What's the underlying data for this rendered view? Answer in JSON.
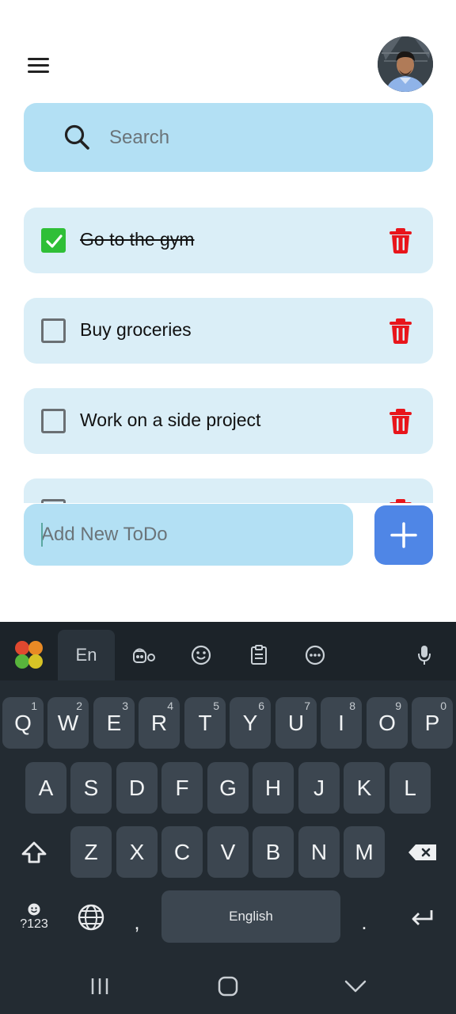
{
  "header": {
    "menu_icon": "hamburger-menu-icon",
    "avatar_icon": "user-avatar"
  },
  "search": {
    "placeholder": "Search",
    "icon": "search-icon"
  },
  "todos": [
    {
      "text": "Go to the gym",
      "done": true
    },
    {
      "text": "Buy groceries",
      "done": false
    },
    {
      "text": "Work on a side project",
      "done": false
    },
    {
      "text": "",
      "done": false
    }
  ],
  "add_todo": {
    "placeholder": "Add New ToDo",
    "button_icon": "plus-icon"
  },
  "colors": {
    "search_bg": "#b3e0f4",
    "todo_bg": "#daeef7",
    "check_done": "#2fbf37",
    "delete_icon": "#e8151b",
    "add_button": "#4f86e6",
    "keyboard_bg": "#232b32"
  },
  "keyboard": {
    "toolbar": {
      "language_tab": "En",
      "icons": [
        "app-logo-icon",
        "sticker-icon",
        "emoji-icon",
        "clipboard-icon",
        "more-icon",
        "microphone-icon"
      ]
    },
    "row1": [
      {
        "key": "Q",
        "hint": "1"
      },
      {
        "key": "W",
        "hint": "2"
      },
      {
        "key": "E",
        "hint": "3"
      },
      {
        "key": "R",
        "hint": "4"
      },
      {
        "key": "T",
        "hint": "5"
      },
      {
        "key": "Y",
        "hint": "6"
      },
      {
        "key": "U",
        "hint": "7"
      },
      {
        "key": "I",
        "hint": "8"
      },
      {
        "key": "O",
        "hint": "9"
      },
      {
        "key": "P",
        "hint": "0"
      }
    ],
    "row2": [
      "A",
      "S",
      "D",
      "F",
      "G",
      "H",
      "J",
      "K",
      "L"
    ],
    "row3": [
      "Z",
      "X",
      "C",
      "V",
      "B",
      "N",
      "M"
    ],
    "symbols_label": "?123",
    "comma": ",",
    "space_label": "English",
    "period": "."
  }
}
